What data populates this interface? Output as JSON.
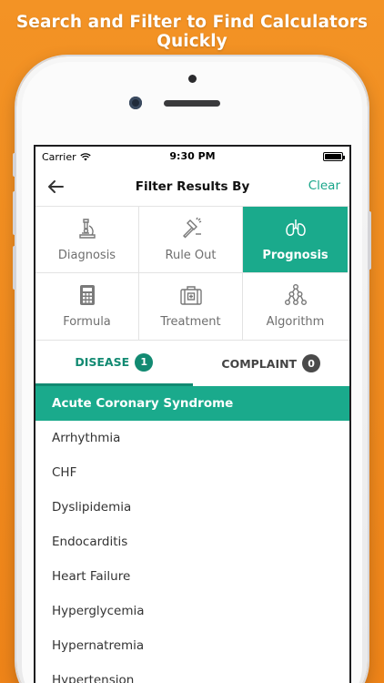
{
  "headline": "Search and Filter to Find Calculators Quickly",
  "status": {
    "carrier": "Carrier",
    "time": "9:30 PM"
  },
  "nav": {
    "title": "Filter Results By",
    "clear_label": "Clear"
  },
  "filters": [
    {
      "label": "Diagnosis",
      "icon": "microscope-icon",
      "active": false
    },
    {
      "label": "Rule Out",
      "icon": "gavel-icon",
      "active": false
    },
    {
      "label": "Prognosis",
      "icon": "lungs-icon",
      "active": true
    },
    {
      "label": "Formula",
      "icon": "calculator-icon",
      "active": false
    },
    {
      "label": "Treatment",
      "icon": "medkit-icon",
      "active": false
    },
    {
      "label": "Algorithm",
      "icon": "tree-icon",
      "active": false
    }
  ],
  "tabs": [
    {
      "label": "DISEASE",
      "count": "1",
      "active": true
    },
    {
      "label": "COMPLAINT",
      "count": "0",
      "active": false
    }
  ],
  "diseases": [
    {
      "label": "Acute Coronary Syndrome",
      "selected": true
    },
    {
      "label": "Arrhythmia",
      "selected": false
    },
    {
      "label": "CHF",
      "selected": false
    },
    {
      "label": "Dyslipidemia",
      "selected": false
    },
    {
      "label": "Endocarditis",
      "selected": false
    },
    {
      "label": "Heart Failure",
      "selected": false
    },
    {
      "label": "Hyperglycemia",
      "selected": false
    },
    {
      "label": "Hypernatremia",
      "selected": false
    },
    {
      "label": "Hypertension",
      "selected": false
    }
  ],
  "colors": {
    "accent": "#1aaa8c",
    "tab_accent": "#128a72",
    "background": "#f08a1e"
  }
}
